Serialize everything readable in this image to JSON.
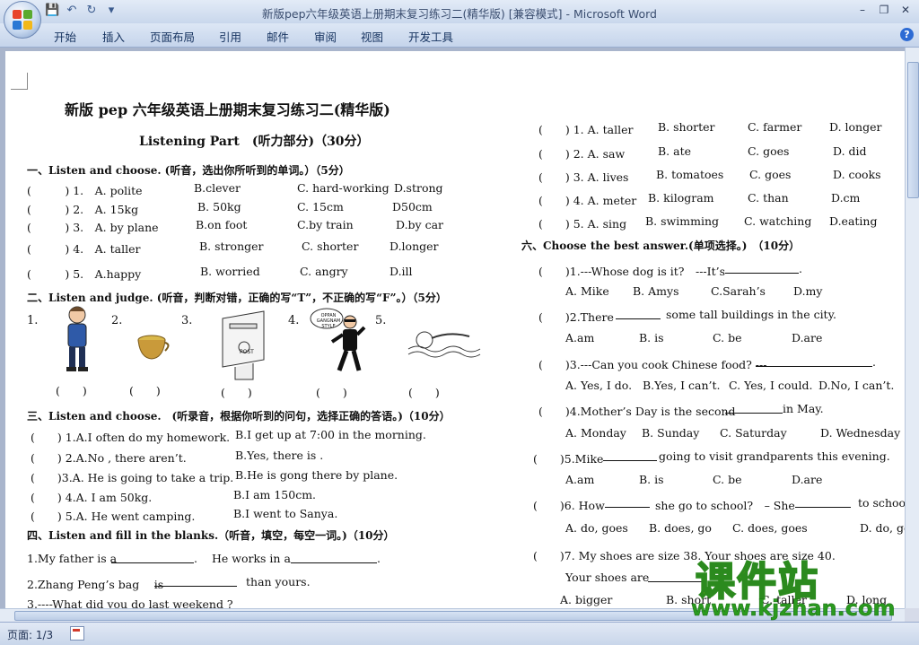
{
  "window": {
    "title": "新版pep六年级英语上册期末复习练习二(精华版) [兼容模式] - Microsoft Word"
  },
  "menu": [
    "开始",
    "插入",
    "页面布局",
    "引用",
    "邮件",
    "审阅",
    "视图",
    "开发工具"
  ],
  "status": {
    "page": "页面: 1/3"
  },
  "doc": {
    "title": "新版 pep 六年级英语上册期末复习练习二(精华版)",
    "subtitle": "Listening Part　(听力部分)（30分）",
    "left": [
      "一、Listen and choose. (听音，选出你所听到的单词。）（5分）",
      "(　　　) 1.　A. polite",
      "B.clever",
      "C. hard-working",
      "D.strong",
      "(　　　) 2.　A. 15kg",
      "B. 50kg",
      "C. 15cm",
      "D50cm",
      "(　　　) 3.　A. by plane",
      "B.on foot",
      "C.by train",
      "D.by car",
      "(　　　) 4.　A. taller",
      "B. stronger",
      "C. shorter",
      "D.longer",
      "(　　　) 5.　A.happy",
      "B. worried",
      "C. angry",
      "D.ill",
      "二、Listen and judge. (听音，判断对错，正确的写“T”，不正确的写“F”。）（5分）",
      "1.",
      "2.",
      "3.",
      "4.",
      "5.",
      "(　　)",
      "(　　)",
      "(　　)",
      "(　　)",
      "(　　)",
      "三、Listen and choose.　(听录音，根据你听到的问句，选择正确的答语。)（10分）",
      "(　　) 1.A.I often do my homework.",
      "B.I get up at 7:00 in the morning.",
      "(　　) 2.A.No , there aren’t.",
      "B.Yes, there is .",
      "(　　)3.A. He is going to take a trip.",
      "B.He is gong there by plane.",
      "(　　) 4.A. I am 50kg.",
      "B.I am 150cm.",
      "(　　) 5.A. He went camping.",
      "B.I went to Sanya.",
      "四、Listen and fill in the blanks.（听音，填空，每空一词。)（10分）",
      "1.My father is a",
      ".",
      "He works in a",
      ".",
      "2.Zhang Peng’s bag　 is",
      "than yours.",
      "3.----What did you do last weekend ?"
    ],
    "pictures": {
      "post_box_label": "POST",
      "gangnam_bubble": "OPPAN GANGNAM STYLE"
    },
    "right": [
      "(　　) 1. A. taller",
      "B. shorter",
      "C. farmer",
      "D. longer",
      "(　　) 2. A. saw",
      "B. ate",
      "C. goes",
      "D. did",
      "(　　) 3. A. lives",
      "B. tomatoes",
      "C. goes",
      "D. cooks",
      "(　　) 4. A. meter",
      "B. kilogram",
      "C. than",
      "D.cm",
      "(　　) 5. A. sing",
      "B. swimming",
      "C. watching",
      "D.eating",
      "六、Choose the best answer.(单项选择。)　（10分）",
      "(　　)1.---Whose dog is it?　---It’s",
      ".",
      "A. Mike",
      "B. Amys",
      "C.Sarah’s",
      "D.my",
      "(　　)2.There",
      "some tall buildings in the city.",
      "A.am",
      "B. is",
      "C. be",
      "D.are",
      "(　　)3.---Can you cook Chinese food? ---",
      ".",
      "A. Yes, I do.",
      "B.Yes, I can’t.",
      "C. Yes, I could.",
      "D.No, I can’t.",
      "(　　)4.Mother’s Day is the second",
      "in May.",
      "A. Monday",
      "B. Sunday",
      "C. Saturday",
      "D. Wednesday",
      "(　　)5.Mike",
      "going to visit grandparents this evening.",
      "A.am",
      "B. is",
      "C. be",
      "D.are",
      "(　　)6. How",
      "she go to school?　– She",
      "to school",
      "A. do, goes",
      "B. does, go",
      "C. does, goes",
      "D. do, go",
      "(　　)7. My shoes are size 38. Your shoes are size 40.",
      "Your shoes are",
      "A. bigger",
      "B. short",
      "C. taller",
      "D. long"
    ]
  },
  "watermark": {
    "main": "课件站",
    "url": "www.kjzhan.com"
  },
  "colors": {
    "title_text": "#3a4d6f",
    "menu_bg": "#c5d4eb",
    "watermark_fill": "#f5d400",
    "watermark_stroke": "#2b8a1e"
  }
}
